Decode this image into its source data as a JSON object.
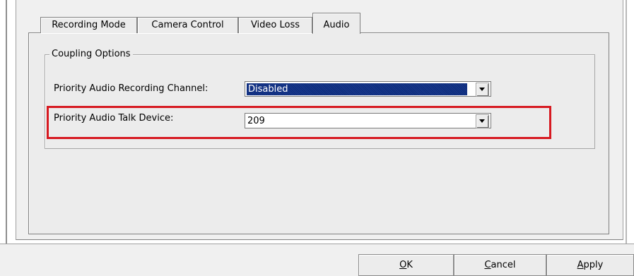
{
  "tabs": [
    {
      "label": "Recording Mode",
      "active": false
    },
    {
      "label": "Camera Control",
      "active": false
    },
    {
      "label": "Video Loss",
      "active": false
    },
    {
      "label": "Audio",
      "active": true
    }
  ],
  "coupling_options": {
    "legend": "Coupling Options",
    "recording_channel": {
      "label": "Priority Audio Recording Channel:",
      "value": "Disabled"
    },
    "talk_device": {
      "label": "Priority Audio Talk Device:",
      "value": "209"
    }
  },
  "buttons": {
    "ok": {
      "first": "O",
      "rest": "K"
    },
    "cancel": {
      "first": "C",
      "rest": "ancel"
    },
    "apply": {
      "first": "A",
      "rest": "pply"
    }
  },
  "colors": {
    "highlight": "#d71920",
    "selection": "#0c2a78"
  }
}
